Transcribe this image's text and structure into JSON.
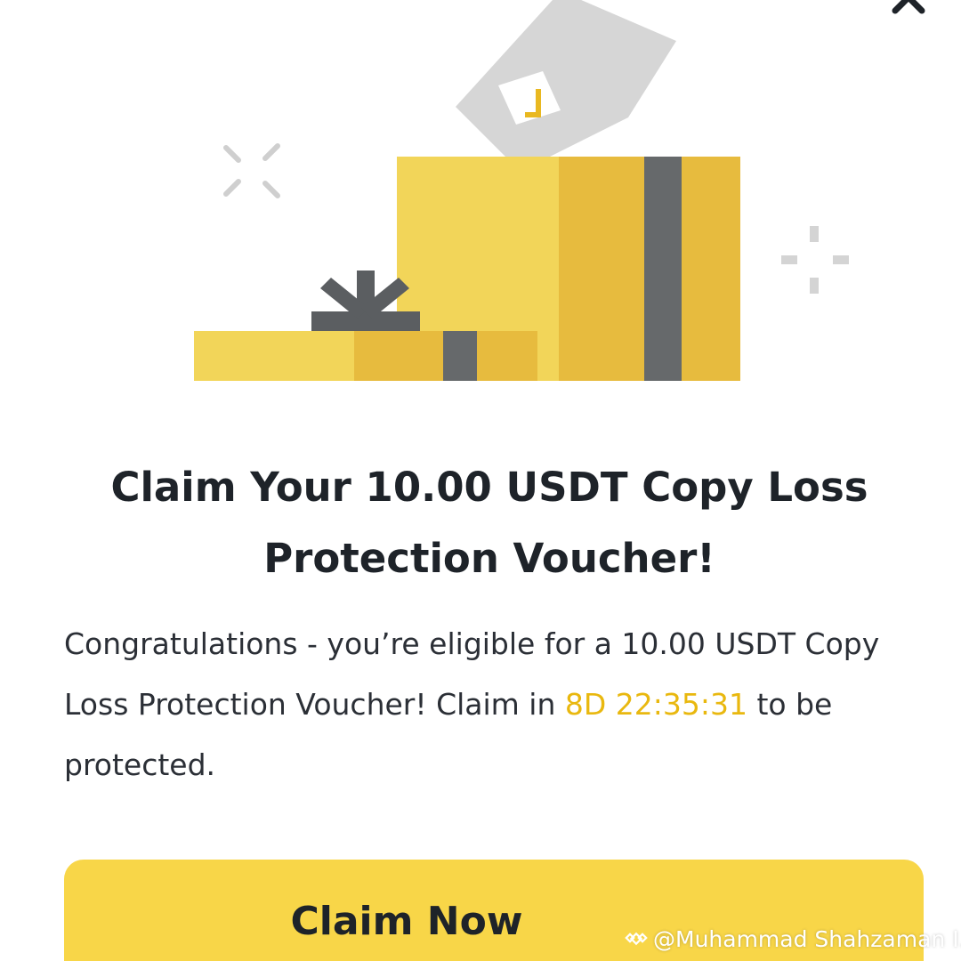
{
  "dialog": {
    "title_line1": "Claim Your 10.00 USDT Copy Loss",
    "title_line2": "Protection Voucher!",
    "description": {
      "text_before": "Congratulations - you’re eligible for a 10.00 USDT Copy Loss Protection Voucher! Claim in ",
      "countdown": "8D 22:35:31",
      "text_after": " to be protected."
    },
    "claim_button_label": "Claim Now",
    "close_icon": "close-icon"
  },
  "watermark": {
    "text": "@Muhammad Shahzaman I...",
    "icon": "binance-logo-icon"
  },
  "colors": {
    "accent_yellow": "#f0d050",
    "button_yellow": "#f8d648",
    "countdown_text": "#e9b80f",
    "title_text": "#1e2329"
  }
}
